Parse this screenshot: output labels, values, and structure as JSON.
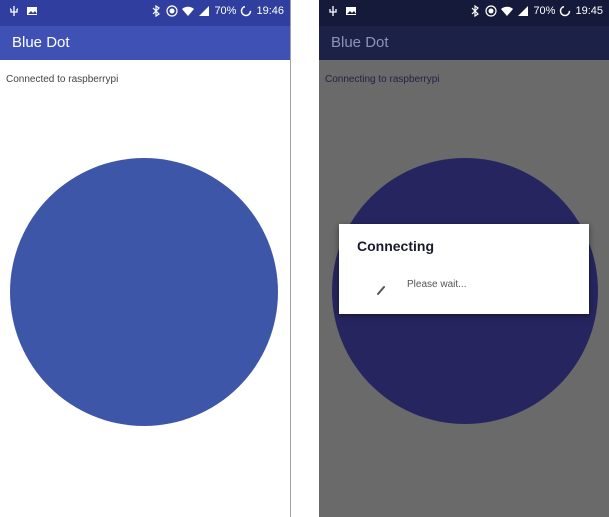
{
  "left_screen": {
    "status_bar": {
      "battery": "70%",
      "time": "19:46",
      "icons": [
        "usb-icon",
        "image-icon",
        "bluetooth-icon",
        "record-icon",
        "wifi-icon",
        "signal-icon",
        "battery-charging-icon"
      ]
    },
    "app_bar": {
      "title": "Blue Dot"
    },
    "status_message": "Connected to raspberrypi",
    "dot_color": "#3d56a8"
  },
  "right_screen": {
    "status_bar": {
      "battery": "70%",
      "time": "19:45",
      "icons": [
        "usb-icon",
        "image-icon",
        "bluetooth-icon",
        "record-icon",
        "wifi-icon",
        "signal-icon",
        "battery-charging-icon"
      ]
    },
    "app_bar": {
      "title": "Blue Dot"
    },
    "status_message": "Connecting to raspberrypi",
    "dot_color": "#272560",
    "dialog": {
      "title": "Connecting",
      "message": "Please wait..."
    }
  },
  "colors": {
    "primary": "#3f51b5",
    "primary_dark": "#303f9f",
    "overlay_gray": "#6a6a6a"
  }
}
